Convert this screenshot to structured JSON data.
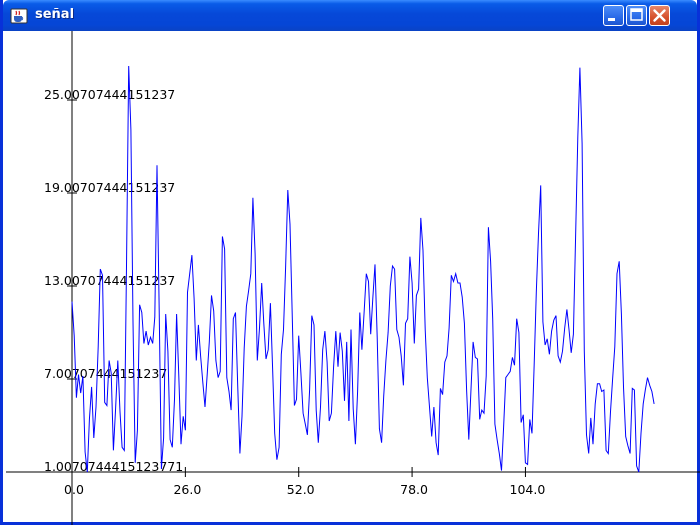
{
  "window": {
    "title": "señal",
    "icon": "java-cup-icon",
    "controls": [
      "minimize",
      "maximize",
      "close"
    ]
  },
  "colors": {
    "series": "#0000ff",
    "axes": "#000000",
    "titlebar": "#0a5ce8",
    "background": "#ffffff"
  },
  "chart_data": {
    "type": "line",
    "x_ticks": [
      "0.0",
      "26.0",
      "52.0",
      "78.0",
      "104.0"
    ],
    "y_ticks": [
      "1.0070744415123771",
      "7.00707444151237",
      "13.00707444151237",
      "19.00707444151237",
      "25.00707444151237"
    ],
    "series": [
      {
        "values": [
          12,
          9.8,
          5.8,
          7.3,
          6.1,
          7.2,
          2.3,
          1,
          4.4,
          6.5,
          3.2,
          5.2,
          9.1,
          14.1,
          13.7,
          5.5,
          5.3,
          8.2,
          7.4,
          2.4,
          5.1,
          8.2,
          4.9,
          2.6,
          2.4,
          14.3,
          27.2,
          23.1,
          10.7,
          1.6,
          3.7,
          11.8,
          11.3,
          9.3,
          10.1,
          9.2,
          9.7,
          9.3,
          11,
          20.8,
          11.4,
          1.2,
          3.2,
          11.2,
          8.8,
          3.1,
          2.6,
          5.7,
          11.2,
          7.2,
          2.8,
          4.6,
          3.7,
          12.6,
          13.8,
          15,
          12.2,
          8.2,
          10.5,
          8.5,
          6.8,
          5.2,
          7.3,
          9.4,
          12.4,
          11.4,
          8.2,
          7.1,
          7.5,
          16.2,
          15.4,
          7.1,
          6.2,
          5,
          10.9,
          11.3,
          6.6,
          2.2,
          4.6,
          9,
          11.7,
          12.7,
          13.8,
          18.7,
          15.1,
          8.2,
          10.3,
          13.2,
          10.6,
          8.3,
          8.9,
          11.9,
          7.7,
          3.5,
          1.8,
          2.6,
          8.6,
          10.2,
          14.2,
          19.2,
          17,
          11.2,
          5.3,
          5.7,
          9.8,
          7.4,
          4.8,
          4.1,
          3.4,
          6.3,
          11.1,
          10.5,
          5,
          2.9,
          5.2,
          8.9,
          10.1,
          8.1,
          4.3,
          4.8,
          7.8,
          10.1,
          7.8,
          10,
          8.8,
          5.6,
          9.4,
          4.3,
          10.2,
          5.1,
          2.8,
          6.2,
          11.3,
          8.9,
          11.3,
          13.8,
          13.3,
          9.9,
          12.2,
          14.4,
          9.7,
          3.8,
          2.9,
          5.9,
          8.2,
          10,
          13,
          14.3,
          14.1,
          10.2,
          9.7,
          8.5,
          6.6,
          10.6,
          10.9,
          14.9,
          13.2,
          9.3,
          12.4,
          12.8,
          17.4,
          15.3,
          10.2,
          7.1,
          5.2,
          3.3,
          5.2,
          2.9,
          2.1,
          6.4,
          6,
          8.1,
          8.5,
          10.3,
          13.7,
          13.3,
          13.8,
          13.2,
          13.2,
          12.3,
          10.6,
          6.3,
          3.1,
          6.2,
          9.4,
          8.4,
          8.3,
          4.4,
          5,
          4.8,
          7.2,
          16.8,
          14.6,
          10.9,
          4.1,
          3.1,
          2.2,
          1.1,
          3.9,
          7.1,
          7.3,
          7.5,
          8.4,
          7.9,
          10.9,
          10,
          4.2,
          4.7,
          1.6,
          1.5,
          4.4,
          3.5,
          8,
          12.6,
          16.4,
          19.5,
          10.7,
          9.2,
          9.6,
          8.6,
          10.1,
          10.8,
          11.1,
          8.5,
          8.1,
          8.8,
          10.3,
          11.5,
          10.2,
          8.7,
          9.9,
          16.2,
          22.6,
          27.1,
          22.2,
          8.8,
          3.4,
          2.2,
          4.5,
          2.8,
          5.4,
          6.7,
          6.7,
          6.2,
          6.3,
          2.4,
          2.2,
          4.9,
          7,
          9.1,
          13.8,
          14.6,
          11.2,
          6.5,
          3.3,
          2.7,
          2.2,
          6.4,
          6.3,
          1.4,
          1,
          3.5,
          5.4,
          6.3,
          7.1,
          6.6,
          6.2,
          5.4
        ]
      }
    ],
    "grid": false,
    "legend": "none"
  }
}
